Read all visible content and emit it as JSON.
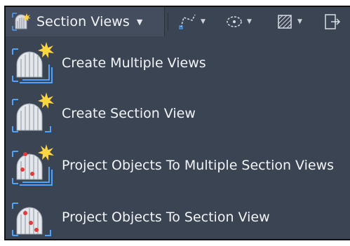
{
  "toolbar": {
    "main_label": "Section Views",
    "main_icon": "section-views-icon",
    "tools": [
      {
        "icon": "polyline-icon"
      },
      {
        "icon": "ellipse-dashed-icon"
      },
      {
        "icon": "hatch-icon"
      },
      {
        "icon": "export-icon"
      }
    ]
  },
  "menu": {
    "items": [
      {
        "label": "Create Multiple Views",
        "icon": "create-multiple-views-icon"
      },
      {
        "label": "Create Section View",
        "icon": "create-section-view-icon"
      },
      {
        "label": "Project Objects To Multiple Section Views",
        "icon": "project-objects-multiple-icon"
      },
      {
        "label": "Project Objects To Section View",
        "icon": "project-objects-section-icon"
      }
    ]
  },
  "colors": {
    "background": "#3b4453",
    "text": "#f2f4f7",
    "accent_star": "#ffd640",
    "accent_blue": "#4fa3ff",
    "accent_red": "#e23b3b"
  }
}
